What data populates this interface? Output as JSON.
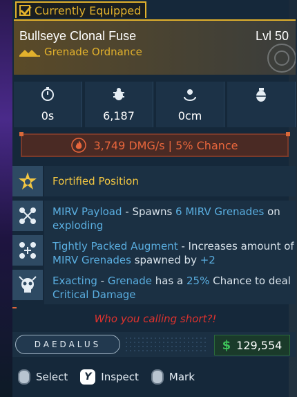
{
  "equipped": {
    "label": "Currently Equipped"
  },
  "item": {
    "name": "Bullseye Clonal Fuse",
    "level": "Lvl 50",
    "type": "Grenade Ordnance"
  },
  "stats": [
    {
      "icon": "timer-icon",
      "value": "0s"
    },
    {
      "icon": "bug-icon",
      "value": "6,187"
    },
    {
      "icon": "radius-icon",
      "value": "0cm"
    },
    {
      "icon": "grenade-icon",
      "value": ""
    }
  ],
  "damage": {
    "text": "3,749 DMG/s | 5% Chance",
    "element": "fire-icon",
    "color": "#e8663c"
  },
  "perks": [
    {
      "icon": "star-badge-icon",
      "name": "Fortified Position",
      "segments": []
    },
    {
      "icon": "mirv-icon",
      "name": "MIRV Payload",
      "segments": [
        " - Spawns ",
        "6 MIRV Grenades",
        " on ",
        "exploding"
      ]
    },
    {
      "icon": "mirv-plus-icon",
      "name": "Tightly Packed Augment",
      "segments": [
        " - Increases amount of ",
        "MIRV Grenades",
        " spawned by ",
        "+2"
      ]
    },
    {
      "icon": "skull-icon",
      "name": "Exacting",
      "segments": [
        " - ",
        "Grenade",
        " has a ",
        "25%",
        " Chance to deal ",
        "Critical Damage"
      ]
    }
  ],
  "flavor": "Who you calling short?!",
  "manufacturer": "DAEDALUS",
  "price": {
    "currency_icon": "$",
    "value": "129,554"
  },
  "controls": [
    {
      "glyph": "",
      "label": "Select"
    },
    {
      "glyph": "Y",
      "label": "Inspect"
    },
    {
      "glyph": "",
      "label": "Mark"
    }
  ]
}
